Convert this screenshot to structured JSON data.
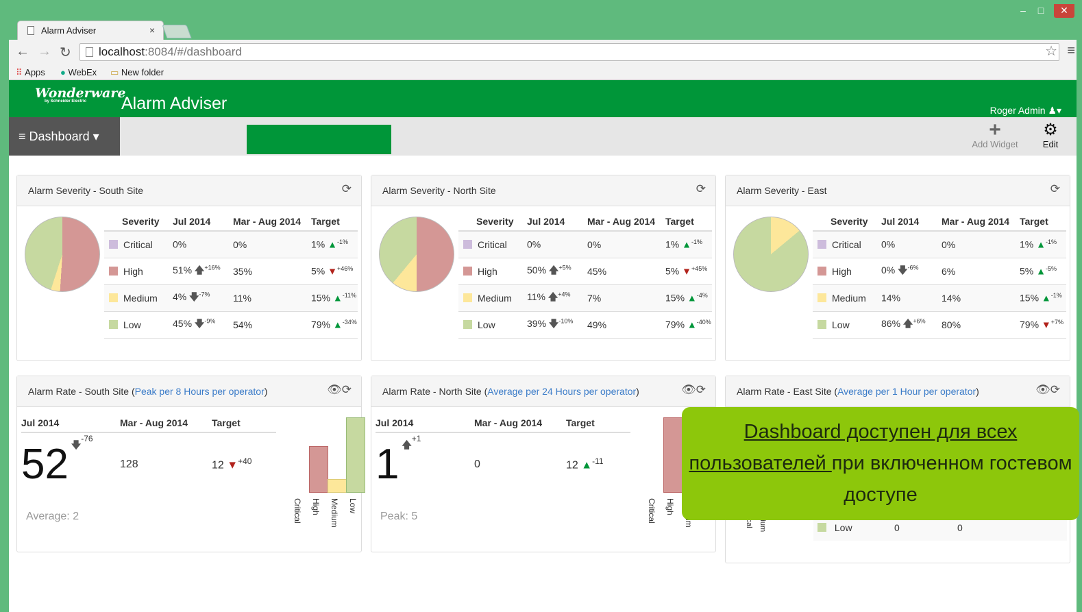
{
  "browser": {
    "tab_title": "Alarm Adviser",
    "url_host": "localhost",
    "url_rest": ":8084/#/dashboard",
    "bookmarks": [
      "Apps",
      "WebEx",
      "New folder"
    ]
  },
  "app": {
    "title": "Alarm Adviser",
    "logo": "Wonderware",
    "logo_sub": "by Schneider Electric",
    "user": "Roger Admin",
    "menu": "Dashboard",
    "add_widget": "Add Widget",
    "edit": "Edit"
  },
  "colors": {
    "critical": "#cdbcdc",
    "high": "#d49795",
    "medium": "#fde79a",
    "low": "#c6d9a0"
  },
  "headers": {
    "severity": [
      "Severity",
      "Jul 2014",
      "Mar - Aug 2014",
      "Target"
    ],
    "rate": [
      "Jul 2014",
      "Mar - Aug 2014",
      "Target"
    ]
  },
  "severity_panels": [
    {
      "title": "Alarm Severity - South Site",
      "pie": [
        0,
        51,
        4,
        45
      ],
      "rows": [
        {
          "label": "Critical",
          "cur": "0%",
          "arrow": "",
          "delta": "",
          "avg": "0%",
          "target": "1%",
          "thumb": "up",
          "tdelta": "-1%"
        },
        {
          "label": "High",
          "cur": "51%",
          "arrow": "up",
          "delta": "+16%",
          "avg": "35%",
          "target": "5%",
          "thumb": "down",
          "tdelta": "+46%"
        },
        {
          "label": "Medium",
          "cur": "4%",
          "arrow": "down",
          "delta": "-7%",
          "avg": "11%",
          "target": "15%",
          "thumb": "up",
          "tdelta": "-11%"
        },
        {
          "label": "Low",
          "cur": "45%",
          "arrow": "down",
          "delta": "-9%",
          "avg": "54%",
          "target": "79%",
          "thumb": "up",
          "tdelta": "-34%"
        }
      ]
    },
    {
      "title": "Alarm Severity - North Site",
      "pie": [
        0,
        50,
        11,
        39
      ],
      "rows": [
        {
          "label": "Critical",
          "cur": "0%",
          "arrow": "",
          "delta": "",
          "avg": "0%",
          "target": "1%",
          "thumb": "up",
          "tdelta": "-1%"
        },
        {
          "label": "High",
          "cur": "50%",
          "arrow": "up",
          "delta": "+5%",
          "avg": "45%",
          "target": "5%",
          "thumb": "down",
          "tdelta": "+45%"
        },
        {
          "label": "Medium",
          "cur": "11%",
          "arrow": "up",
          "delta": "+4%",
          "avg": "7%",
          "target": "15%",
          "thumb": "up",
          "tdelta": "-4%"
        },
        {
          "label": "Low",
          "cur": "39%",
          "arrow": "down",
          "delta": "-10%",
          "avg": "49%",
          "target": "79%",
          "thumb": "up",
          "tdelta": "-40%"
        }
      ]
    },
    {
      "title": "Alarm Severity - East",
      "pie": [
        0,
        0,
        14,
        86
      ],
      "rows": [
        {
          "label": "Critical",
          "cur": "0%",
          "arrow": "",
          "delta": "",
          "avg": "0%",
          "target": "1%",
          "thumb": "up",
          "tdelta": "-1%"
        },
        {
          "label": "High",
          "cur": "0%",
          "arrow": "down",
          "delta": "-6%",
          "avg": "6%",
          "target": "5%",
          "thumb": "up",
          "tdelta": "-5%"
        },
        {
          "label": "Medium",
          "cur": "14%",
          "arrow": "",
          "delta": "",
          "avg": "14%",
          "target": "15%",
          "thumb": "up",
          "tdelta": "-1%"
        },
        {
          "label": "Low",
          "cur": "86%",
          "arrow": "up",
          "delta": "+6%",
          "avg": "80%",
          "target": "79%",
          "thumb": "down",
          "tdelta": "+7%"
        }
      ]
    }
  ],
  "rate_panels": [
    {
      "title": "Alarm Rate - South Site",
      "link": "Peak per 8 Hours per operator",
      "value": "52",
      "arrow": "down",
      "delta": "-76",
      "avg": "128",
      "target": "12",
      "thumb": "down",
      "tdelta": "+40",
      "caption": "Average: 2",
      "bars": [
        0,
        62,
        18,
        100
      ]
    },
    {
      "title": "Alarm Rate - North Site",
      "link": "Average per 24 Hours per operator",
      "value": "1",
      "arrow": "up",
      "delta": "+1",
      "avg": "0",
      "target": "12",
      "thumb": "up",
      "tdelta": "-11",
      "caption": "Peak: 5",
      "bars": [
        0,
        100,
        0,
        0
      ]
    },
    {
      "title": "Alarm Rate - East Site",
      "link": "Average per 1 Hour per operator",
      "low_row": {
        "label": "Low",
        "cur": "0",
        "avg": "0"
      },
      "axis": [
        "Critical",
        "High",
        "Medium",
        "Low"
      ]
    }
  ],
  "bar_labels": [
    "Critical",
    "High",
    "Medium",
    "Low"
  ],
  "callout": {
    "part1": "Dashboard доступен для всех пользователей ",
    "part2": "при включенном гостевом доступе"
  }
}
